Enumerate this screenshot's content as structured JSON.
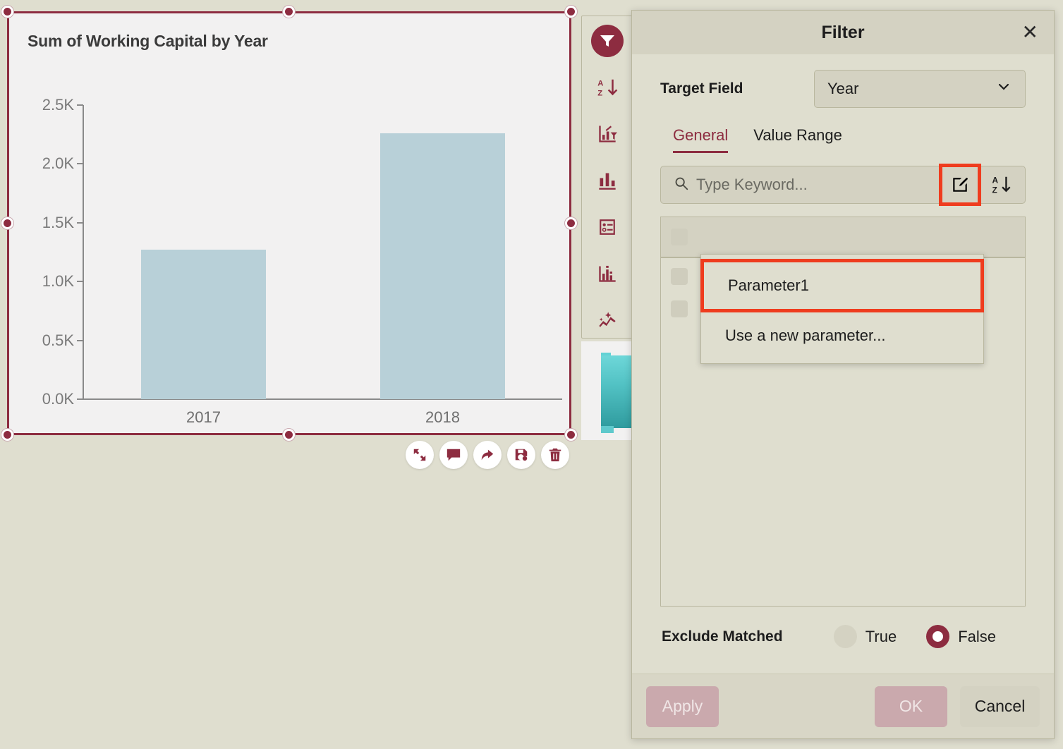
{
  "colors": {
    "accent": "#8d2c40",
    "panel_bg": "#dfdecf",
    "header_bg": "#d4d2c2",
    "chart_bg": "#f2f1f1",
    "bar": "#b8d0d8",
    "highlight": "#ef3c1e",
    "teal": "#52c2c4"
  },
  "chart_widget": {
    "title": "Sum of Working Capital by Year",
    "actions": [
      {
        "name": "expand-button",
        "icon": "expand-icon"
      },
      {
        "name": "comment-button",
        "icon": "comment-icon"
      },
      {
        "name": "share-button",
        "icon": "share-arrow-icon"
      },
      {
        "name": "save-button",
        "icon": "save-icon"
      },
      {
        "name": "delete-button",
        "icon": "trash-icon"
      }
    ]
  },
  "chart_data": {
    "type": "bar",
    "title": "Sum of Working Capital by Year",
    "categories": [
      "2017",
      "2018"
    ],
    "values": [
      1270,
      2260
    ],
    "xlabel": "",
    "ylabel": "",
    "ylim": [
      0,
      2500
    ],
    "ytick_values": [
      0,
      500,
      1000,
      1500,
      2000,
      2500
    ],
    "ytick_labels": [
      "0.0K",
      "0.5K",
      "1.0K",
      "1.5K",
      "2.0K",
      "2.5K"
    ],
    "grid": false,
    "legend": "none",
    "series": [
      {
        "name": "Sum of Working Capital",
        "values": [
          1270,
          2260
        ]
      }
    ]
  },
  "toolbar": {
    "items": [
      {
        "name": "filter-tool",
        "icon": "filter-icon",
        "active": true
      },
      {
        "name": "sort-tool",
        "icon": "sort-az-icon",
        "active": false
      },
      {
        "name": "chart-filter-tool",
        "icon": "chart-filter-icon",
        "active": false
      },
      {
        "name": "bar-chart-tool",
        "icon": "bar-chart-icon",
        "active": false
      },
      {
        "name": "legend-tool",
        "icon": "legend-list-icon",
        "active": false
      },
      {
        "name": "histogram-tool",
        "icon": "histogram-icon",
        "active": false
      },
      {
        "name": "trendline-tool",
        "icon": "trend-line-icon",
        "active": false
      }
    ]
  },
  "dialog": {
    "title": "Filter",
    "close_label": "✕",
    "target_field": {
      "label": "Target Field",
      "value": "Year",
      "options": [
        "Year"
      ]
    },
    "tabs": [
      {
        "label": "General",
        "active": true
      },
      {
        "label": "Value Range",
        "active": false
      }
    ],
    "search": {
      "placeholder": "Type Keyword...",
      "value": "",
      "edit_button": "edit-parameter-icon",
      "sort_button": "sort-az-icon"
    },
    "popup": {
      "items": [
        {
          "label": "Parameter1",
          "highlighted": true
        },
        {
          "label": "Use a new parameter...",
          "highlighted": false
        }
      ]
    },
    "exclude": {
      "label": "Exclude Matched",
      "options": [
        {
          "label": "True",
          "selected": false
        },
        {
          "label": "False",
          "selected": true
        }
      ]
    },
    "footer": {
      "apply": "Apply",
      "ok": "OK",
      "cancel": "Cancel"
    }
  }
}
